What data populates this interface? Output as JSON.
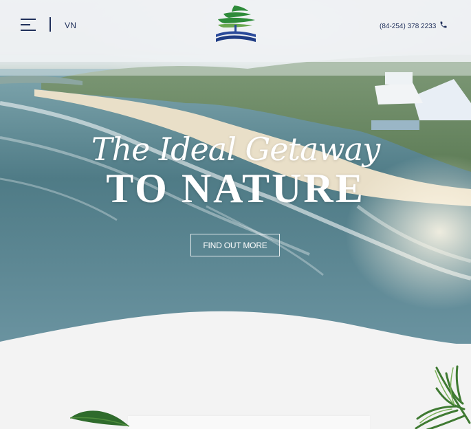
{
  "header": {
    "language_label": "VN",
    "phone_label": "(84-254) 378 2233"
  },
  "hero": {
    "script_heading": "The Ideal Getaway",
    "main_heading": "TO NATURE",
    "cta_label": "FIND OUT MORE"
  },
  "colors": {
    "navy": "#1f2f5a",
    "brand_green": "#2e8b3a",
    "brand_blue": "#2a4a9a",
    "hero_text": "#ffffff",
    "section_bg": "#f3f3f3"
  },
  "icons": {
    "menu": "hamburger-icon",
    "phone": "phone-icon",
    "logo": "pine-tree-wave-logo"
  }
}
